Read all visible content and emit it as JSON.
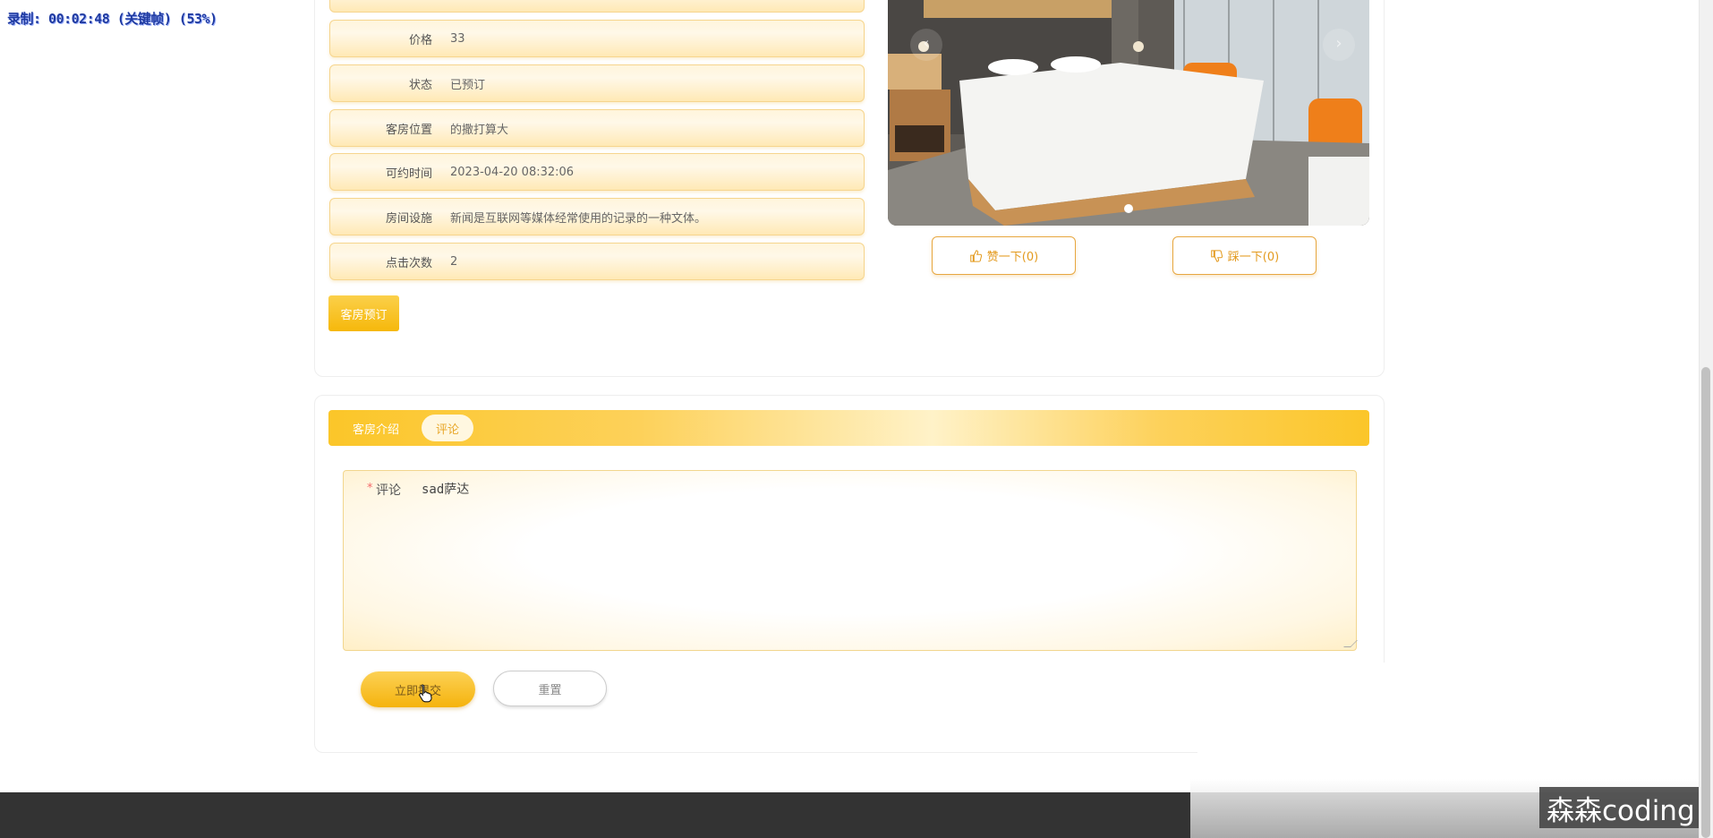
{
  "overlay": {
    "recording_text": "录制: 00:02:48 (关键帧) (53%)"
  },
  "details": {
    "fields": [
      {
        "label": "价格",
        "value": "33"
      },
      {
        "label": "状态",
        "value": "已预订"
      },
      {
        "label": "客房位置",
        "value": "的撒打算大"
      },
      {
        "label": "可约时间",
        "value": "2023-04-20 08:32:06"
      },
      {
        "label": "房间设施",
        "value": "新闻是互联网等媒体经常使用的记录的一种文体。"
      },
      {
        "label": "点击次数",
        "value": "2"
      }
    ],
    "book_button": "客房预订"
  },
  "carousel": {
    "prev_icon": "chevron-left-icon",
    "next_icon": "chevron-right-icon",
    "next_glyph": "›",
    "prev_glyph": "‹"
  },
  "votes": {
    "like_label": "赞一下(0)",
    "dislike_label": "踩一下(0)"
  },
  "tabs": {
    "intro": "客房介绍",
    "comment": "评论"
  },
  "comment_form": {
    "required_mark": "*",
    "label": "评论",
    "value": "sad萨达",
    "submit_label": "立即提交",
    "reset_label": "重置"
  },
  "watermark": {
    "text": "森森coding"
  },
  "colors": {
    "accent": "#f6b80b",
    "accent_light": "#fff5dc",
    "footer": "#333333"
  }
}
